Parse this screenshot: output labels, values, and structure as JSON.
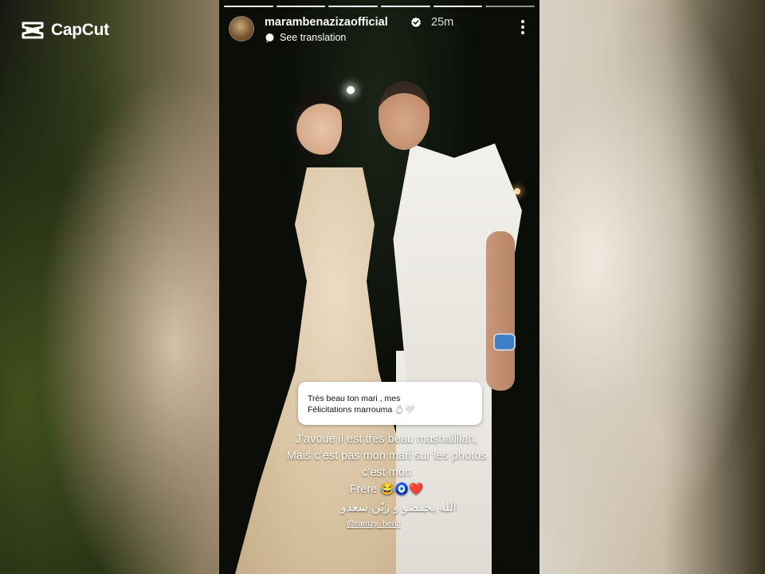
{
  "brand": {
    "watermark": "CapCut"
  },
  "story": {
    "progress_segments": 6,
    "progress_completed": 5,
    "header": {
      "username": "marambenazizaofficial",
      "verified": true,
      "time_ago": "25m",
      "translate_label": "See translation"
    },
    "reply_sticker": {
      "line1": "Très beau ton mari , mes",
      "line2": "Félicitations marrouma",
      "emoji": "💍🤍"
    },
    "caption": {
      "line1": "J’avoue il est très beau mashallllah,",
      "line2": "Mais c’est pas mon mari sur les photos",
      "line3": "c’est mon",
      "line4": "Frère 😂🧿❤️",
      "arabic": "الله يحفضو و زيّن سعدو",
      "mention": "@ramzy_benz"
    }
  },
  "colors": {
    "verified_badge": "#ffffff",
    "text": "#ffffff"
  },
  "icons": {
    "logo": "capcut-logo-icon",
    "verified": "verified-badge-icon",
    "translate": "translate-icon",
    "menu": "more-vertical-icon"
  }
}
